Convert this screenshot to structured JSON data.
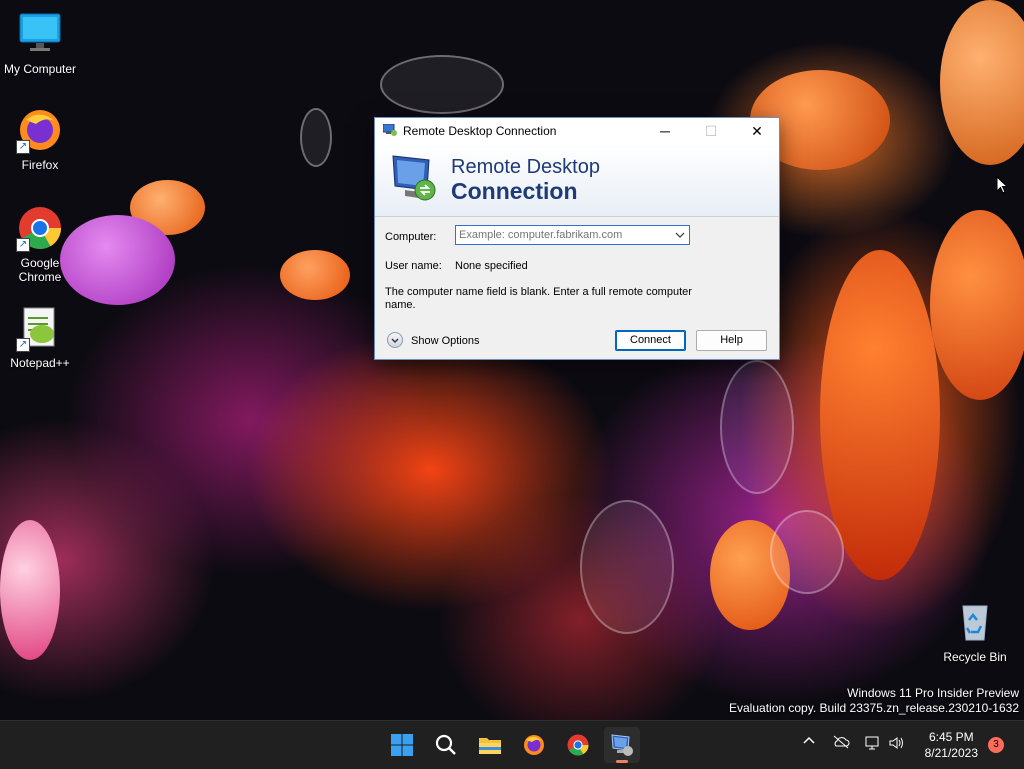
{
  "desktop": {
    "icons": [
      {
        "label": "My Computer"
      },
      {
        "label": "Firefox"
      },
      {
        "label": "Google Chrome"
      },
      {
        "label": "Notepad++"
      },
      {
        "label": "Recycle Bin"
      }
    ],
    "watermark": {
      "line1": "Windows 11 Pro Insider Preview",
      "line2": "Evaluation copy. Build 23375.zn_release.230210-1632"
    }
  },
  "dialog": {
    "title": "Remote Desktop Connection",
    "banner_line1": "Remote Desktop",
    "banner_line2": "Connection",
    "computer_label": "Computer:",
    "computer_value": "",
    "computer_placeholder": "Example: computer.fabrikam.com",
    "username_label": "User name:",
    "username_value": "None specified",
    "message": "The computer name field is blank. Enter a full remote computer name.",
    "show_options": "Show Options",
    "connect": "Connect",
    "help": "Help",
    "minimize_glyph": "─",
    "maximize_glyph": "☐",
    "close_glyph": "✕"
  },
  "taskbar": {
    "pinned": [
      "start-icon",
      "search-icon",
      "file-explorer-icon",
      "firefox-icon",
      "chrome-icon",
      "remote-desktop-icon"
    ],
    "time": "6:45 PM",
    "date": "8/21/2023",
    "notification_count": "3"
  },
  "colors": {
    "accent": "#0067c0",
    "banner_text": "#1e3a78",
    "taskbar": "#202020"
  }
}
